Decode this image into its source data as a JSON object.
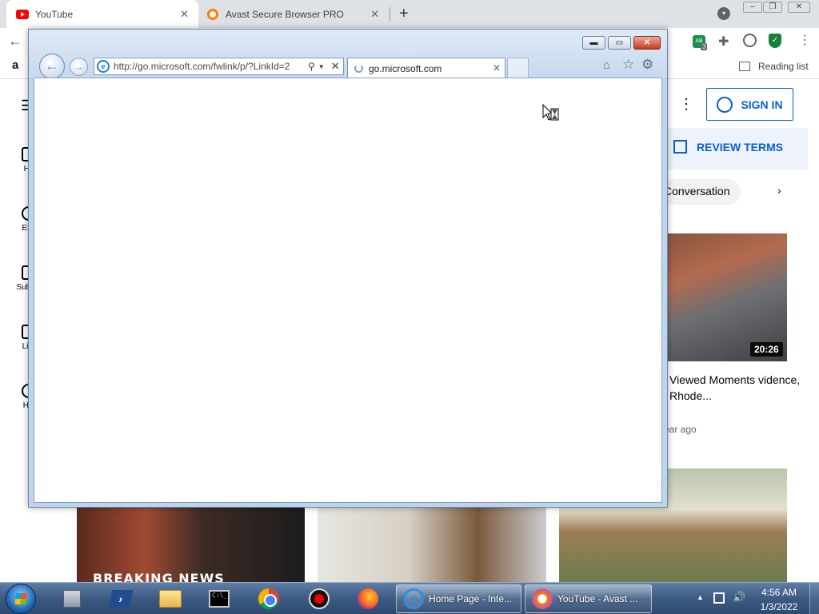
{
  "chrome": {
    "tabs": [
      {
        "title": "YouTube",
        "icon": "youtube-icon"
      },
      {
        "title": "Avast Secure Browser PRO",
        "icon": "avast-icon"
      }
    ],
    "new_tab_glyph": "+",
    "close_glyph": "✕",
    "extension_badge": "AB",
    "extension_count": "3",
    "bookmark_amazon": "a",
    "reading_list": "Reading list"
  },
  "youtube": {
    "nav": [
      {
        "label": "Ho",
        "icon": "home-icon"
      },
      {
        "label": "Exp",
        "icon": "compass-icon"
      },
      {
        "label": "Subscr",
        "icon": "subscriptions-icon"
      },
      {
        "label": "Libr",
        "icon": "library-icon"
      },
      {
        "label": "His",
        "icon": "history-icon"
      }
    ],
    "sign_in": "SIGN IN",
    "review_terms": "REVIEW TERMS",
    "chip": "Conversation",
    "video_right": {
      "duration": "20:26",
      "title": "Viewed Moments vidence, Rhode...",
      "meta": "ear ago"
    },
    "breaking_overlay": "BREAKING NEWS"
  },
  "ie": {
    "url": "http://go.microsoft.com/fwlink/p/?LinkId=2",
    "tab_title": "go.microsoft.com",
    "back_glyph": "←",
    "forward_glyph": "→"
  },
  "taskbar": {
    "tasks": [
      {
        "label": "Home Page - Inte...",
        "icon": "internet-explorer-icon"
      },
      {
        "label": "YouTube - Avast ...",
        "icon": "avast-browser-icon"
      }
    ],
    "clock_time": "4:56 AM",
    "clock_date": "1/3/2022",
    "cmd_glyph": "C:\\_"
  },
  "colors": {
    "youtube_blue": "#065fd4",
    "ie_frame": "#bdd5ec",
    "taskbar": "#3d5a82"
  }
}
